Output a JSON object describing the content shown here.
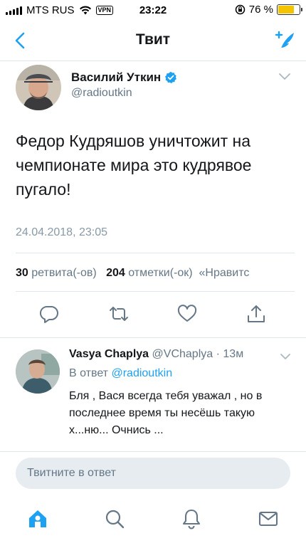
{
  "status_bar": {
    "carrier": "MTS RUS",
    "vpn": "VPN",
    "time": "23:22",
    "battery": "76 %",
    "battery_level": 0.76,
    "battery_color": "#f5c400"
  },
  "nav": {
    "title": "Твит",
    "back_icon": "chevron-left-icon",
    "compose_icon": "compose-tweet-icon"
  },
  "tweet": {
    "author_name": "Василий Уткин",
    "author_handle": "@radioutkin",
    "verified": true,
    "text": "Федор Кудряшов уничтожит на чемпионате мира это кудрявое пугало!",
    "date": "24.04.2018, 23:05",
    "retweets_count": "30",
    "retweets_label": "ретвита(-ов)",
    "likes_count": "204",
    "likes_label": "отметки(-ок)",
    "more_label": "«Нравитс"
  },
  "reply": {
    "author_name": "Vasya Chaplya",
    "author_handle": "@VChaplya",
    "time": "13м",
    "reply_to_prefix": "В ответ",
    "reply_to_handle": "@radioutkin",
    "text": "Бля , Вася всегда тебя уважал , но в последнее время ты несёшь такую х...ню... Очнись ..."
  },
  "composer": {
    "placeholder": "Твитните в ответ"
  },
  "tabbar": {
    "items": [
      "home-icon",
      "search-icon",
      "notifications-icon",
      "messages-icon"
    ]
  },
  "colors": {
    "accent": "#1da1f2",
    "secondary_text": "#657786",
    "divider": "#e1e8ed"
  }
}
